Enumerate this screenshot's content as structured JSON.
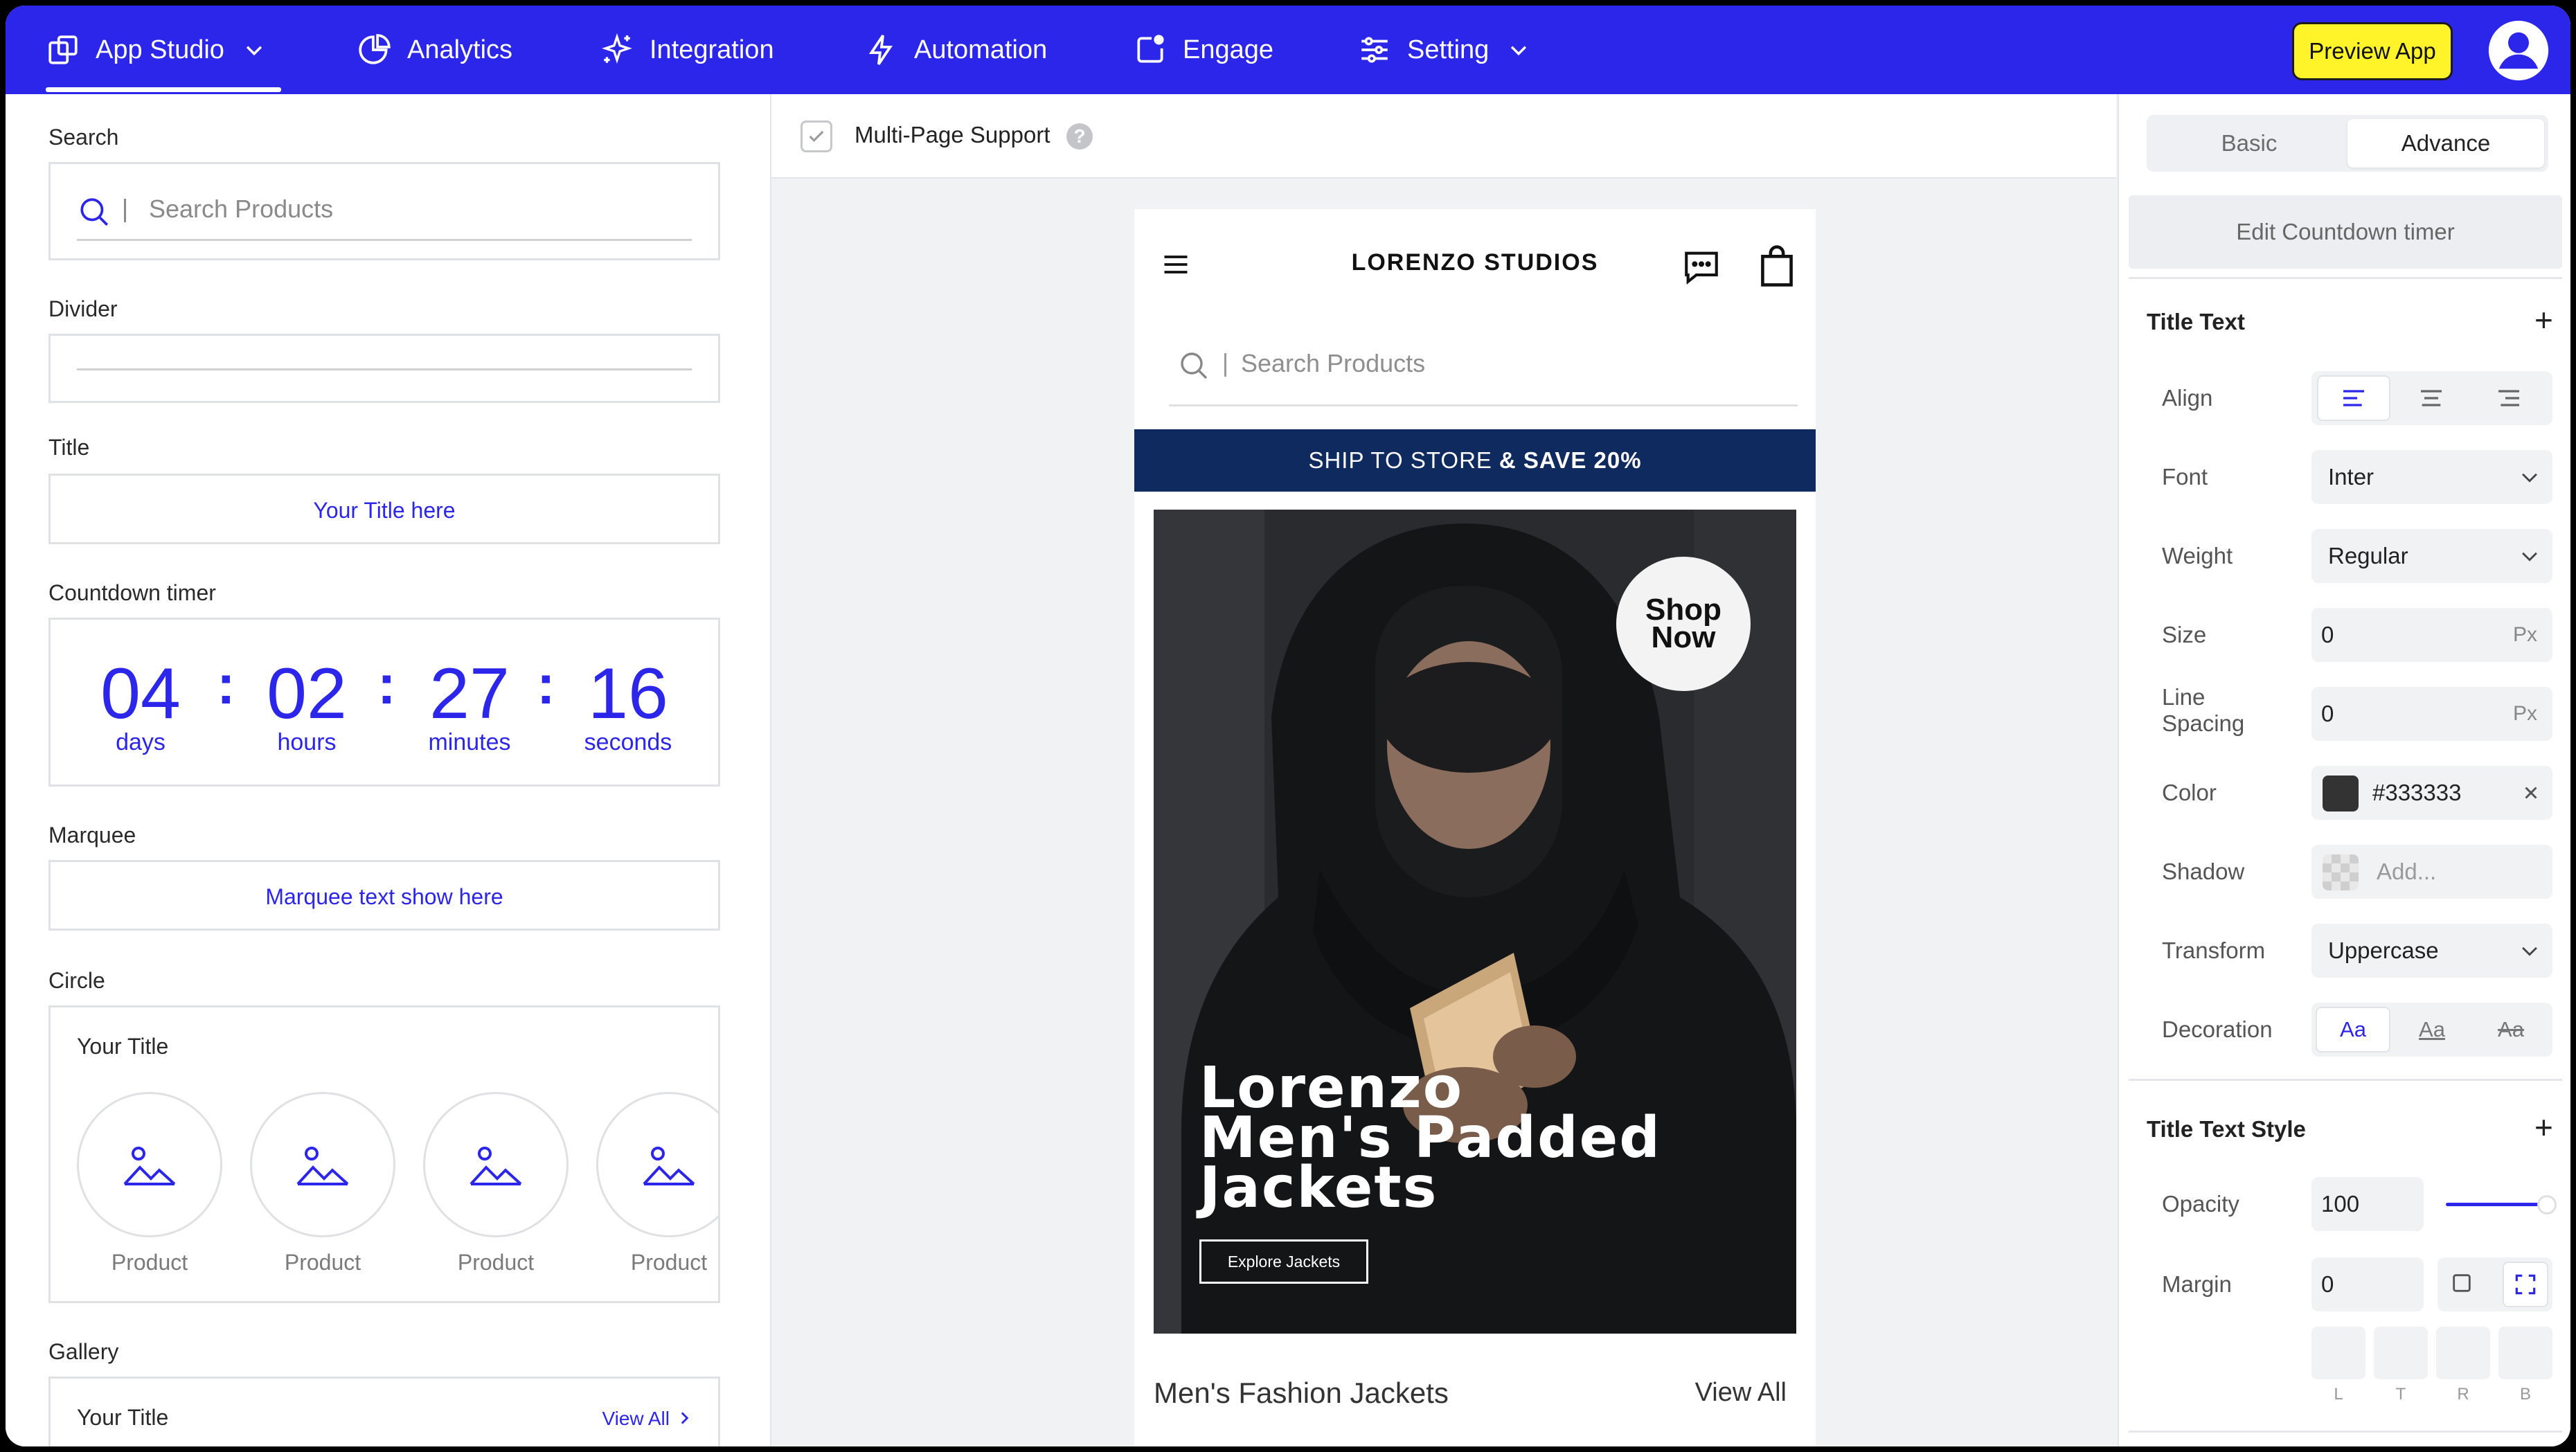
{
  "nav": {
    "items": [
      {
        "label": "App Studio",
        "icon": "app-studio-icon"
      },
      {
        "label": "Analytics",
        "icon": "pie-chart-icon"
      },
      {
        "label": "Integration",
        "icon": "sparkle-icon"
      },
      {
        "label": "Automation",
        "icon": "lightning-icon"
      },
      {
        "label": "Engage",
        "icon": "engage-icon"
      },
      {
        "label": "Setting",
        "icon": "sliders-icon"
      }
    ],
    "preview_label": "Preview App",
    "accent": "#2c26ea"
  },
  "left": {
    "search": {
      "label": "Search",
      "placeholder": "Search Products"
    },
    "divider": {
      "label": "Divider"
    },
    "title": {
      "label": "Title",
      "text": "Your Title here"
    },
    "countdown": {
      "label": "Countdown timer",
      "days": "04",
      "hours": "02",
      "minutes": "27",
      "seconds": "16",
      "units": {
        "days": "days",
        "hours": "hours",
        "minutes": "minutes",
        "seconds": "seconds"
      }
    },
    "marquee": {
      "label": "Marquee",
      "text": "Marquee text show here"
    },
    "circle": {
      "label": "Circle",
      "title": "Your Title",
      "items": [
        "Product",
        "Product",
        "Product",
        "Product"
      ]
    },
    "gallery": {
      "label": "Gallery",
      "title": "Your Title",
      "view_all": "View All"
    }
  },
  "center": {
    "multi_page_label": "Multi-Page Support",
    "help": "?",
    "phone": {
      "brand": "LORENZO STUDIOS",
      "search_placeholder": "Search Products",
      "banner_prefix": "SHIP TO STORE",
      "banner_bold": "& SAVE 20%",
      "shop_now_1": "Shop",
      "shop_now_2": "Now",
      "hero_title_1": "Lorenzo",
      "hero_title_2": "Men's Padded",
      "hero_title_3": "Jackets",
      "hero_button": "Explore Jackets",
      "section_title": "Men's Fashion Jackets",
      "section_view_all": "View All"
    }
  },
  "right": {
    "tabs": [
      "Basic",
      "Advance"
    ],
    "edit_button": "Edit Countdown timer",
    "title_text": {
      "heading": "Title Text",
      "align_label": "Align",
      "font_label": "Font",
      "font_value": "Inter",
      "weight_label": "Weight",
      "weight_value": "Regular",
      "size_label": "Size",
      "size_value": "0",
      "size_unit": "Px",
      "line_spacing_label_1": "Line",
      "line_spacing_label_2": "Spacing",
      "line_spacing_value": "0",
      "line_spacing_unit": "Px",
      "color_label": "Color",
      "color_value": "#333333",
      "shadow_label": "Shadow",
      "shadow_placeholder": "Add...",
      "transform_label": "Transform",
      "transform_value": "Uppercase",
      "decoration_label": "Decoration",
      "decoration_options": [
        "Aa",
        "Aa",
        "Aa"
      ]
    },
    "title_text_style": {
      "heading": "Title Text Style",
      "opacity_label": "Opacity",
      "opacity_value": "100",
      "margin_label": "Margin",
      "margin_value": "0",
      "sides": [
        "L",
        "T",
        "R",
        "B"
      ]
    }
  }
}
